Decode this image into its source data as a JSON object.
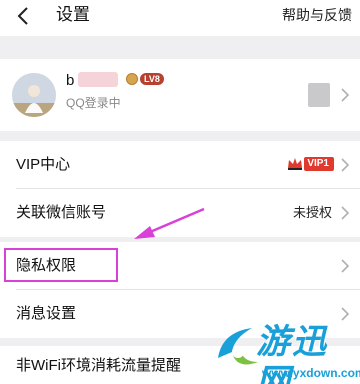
{
  "header": {
    "title": "设置",
    "help_link": "帮助与反馈"
  },
  "profile": {
    "nickname_visible": "b",
    "level_badge": "LV8",
    "login_status": "QQ登录中"
  },
  "rows": [
    {
      "label": "VIP中心",
      "value": "",
      "badge": "VIP1"
    },
    {
      "label": "关联微信账号",
      "value": "未授权"
    },
    {
      "label": "隐私权限",
      "value": ""
    },
    {
      "label": "消息设置",
      "value": ""
    },
    {
      "label": "非WiFi环境消耗流量提醒",
      "value": ""
    }
  ],
  "watermark": {
    "text": "游迅网",
    "url": "www.yxdown.com"
  },
  "colors": {
    "highlight": "#d840d8",
    "vip_red": "#e03a2e",
    "watermark_blue": "#1aa0d8"
  },
  "icons": {
    "back": "chevron-left-icon",
    "row_arrow": "chevron-right-icon",
    "vip": "crown-icon"
  }
}
